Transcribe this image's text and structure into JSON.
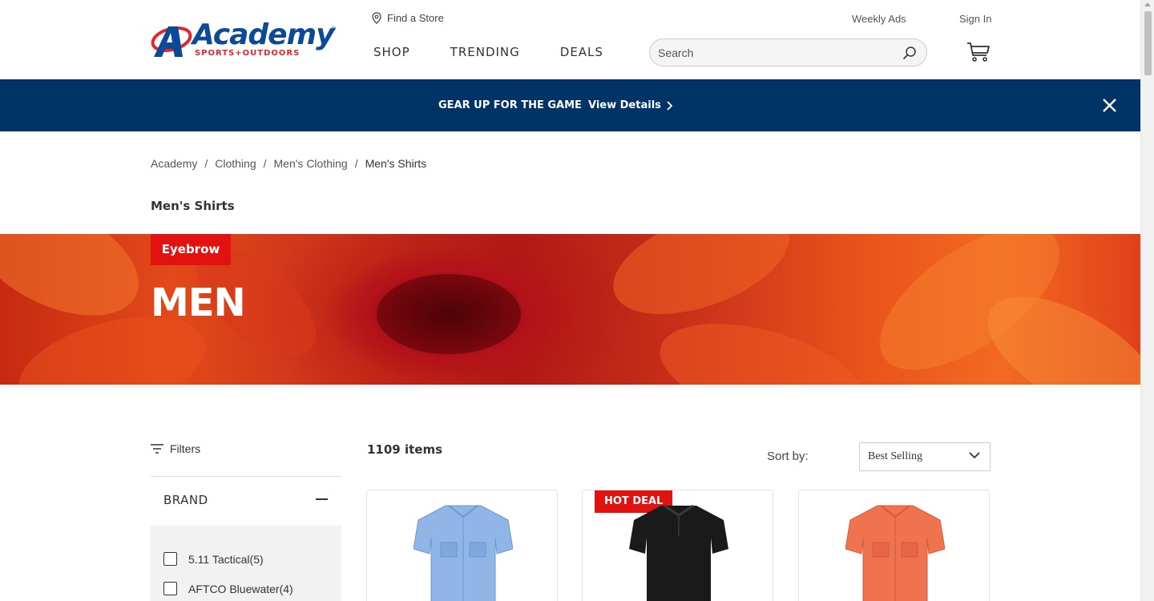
{
  "header": {
    "logo": {
      "brand": "Academy",
      "tagline": "SPORTS+OUTDOORS"
    },
    "find_store": "Find a Store",
    "weekly_ads": "Weekly Ads",
    "sign_in": "Sign In",
    "nav": [
      "SHOP",
      "TRENDING",
      "DEALS"
    ],
    "search_placeholder": "Search"
  },
  "promo": {
    "text": "GEAR UP FOR THE GAME",
    "link": "View Details",
    "bg_color": "#003366"
  },
  "breadcrumb": [
    "Academy",
    "Clothing",
    "Men's Clothing",
    "Men's Shirts"
  ],
  "page_title": "Men's Shirts",
  "hero": {
    "eyebrow": "Eyebrow",
    "title": "MEN",
    "accent_color": "#e1120f"
  },
  "filters": {
    "label": "Filters",
    "brand_section": "BRAND",
    "brands": [
      {
        "name": "5.11 Tactical",
        "count": "(5)"
      },
      {
        "name": "AFTCO Bluewater",
        "count": "(4)"
      }
    ]
  },
  "results": {
    "count": "1109 items",
    "sort_label": "Sort by:",
    "sort_value": "Best Selling"
  },
  "products": [
    {
      "badge": "",
      "shirt_color": "#8fb6e6"
    },
    {
      "badge": "HOT DEAL",
      "shirt_color": "#1a1a1a"
    },
    {
      "badge": "",
      "shirt_color": "#f07350"
    }
  ]
}
